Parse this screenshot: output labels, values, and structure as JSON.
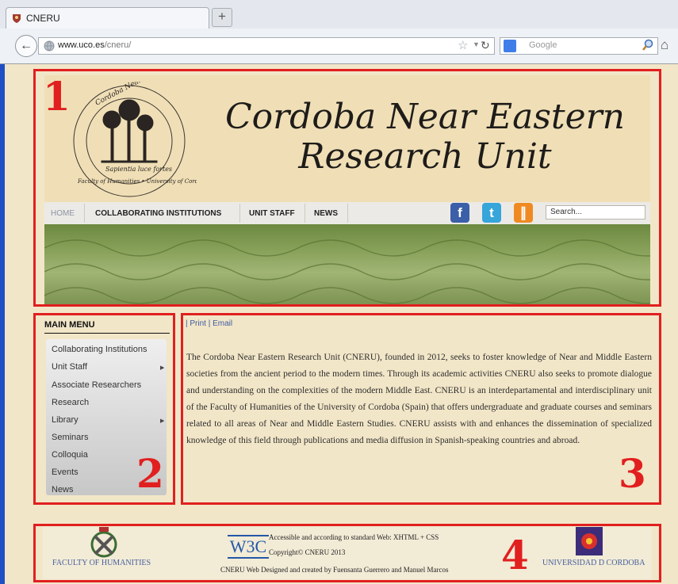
{
  "browser": {
    "tab_title": "CNERU",
    "new_tab": "+",
    "url_host": "www.uco.es",
    "url_path": "/cneru/",
    "search_placeholder": "Google"
  },
  "site": {
    "title_line1": "Cordoba Near Eastern",
    "title_line2": "Research Unit",
    "logo_texts": {
      "top_arc": "Cordoba Near Eastern Research Unit",
      "motto": "Sapientia  luce fortes",
      "bottom_arc": "Faculty of Humanities • University of Cordoba"
    },
    "nav": [
      "HOME",
      "COLLABORATING INSTITUTIONS",
      "UNIT STAFF",
      "NEWS"
    ],
    "search_value": "Search..."
  },
  "main_menu": {
    "title": "MAIN MENU",
    "items": [
      {
        "label": "Collaborating Institutions"
      },
      {
        "label": "Unit Staff"
      },
      {
        "label": "Associate Researchers"
      },
      {
        "label": "Research"
      },
      {
        "label": "Library"
      },
      {
        "label": "Seminars"
      },
      {
        "label": "Colloquia"
      },
      {
        "label": "Events"
      },
      {
        "label": "News"
      }
    ]
  },
  "content": {
    "print_link": "| Print |",
    "email_link": "Email",
    "paragraph": "The Cordoba Near Eastern Research Unit (CNERU), founded in 2012, seeks to foster knowledge of Near and Middle Eastern societies from the ancient period to the modern times. Through its academic activities CNERU also seeks to promote dialogue and understanding on the complexities of the modern Middle East. CNERU is an interdepartamental and interdisciplinary unit of the Faculty of Humanities of the University of Cordoba (Spain) that offers undergraduate and graduate courses and seminars related to all areas of Near and Middle Eastern Studies. CNERU assists with and enhances the dissemination of specialized knowledge of this field through publications and media diffusion in Spanish-speaking countries and abroad."
  },
  "footer": {
    "faculty": "FACULTY OF HUMANITIES",
    "w3c": "W3C",
    "accessible": "Accessible and according to standard Web: XHTML + CSS",
    "copyright": "Copyright© CNERU 2013",
    "credits": "CNERU Web Designed and created by Fuensanta Guerrero and Manuel Marcos",
    "university": "UNIVERSIDAD D CORDOBA"
  },
  "annotations": {
    "n1": "1",
    "n2": "2",
    "n3": "3",
    "n4": "4"
  },
  "colors": {
    "annotation": "#e11f1f",
    "page_bg": "#f2e6c8",
    "browser_edge": "#1f4fc5"
  }
}
